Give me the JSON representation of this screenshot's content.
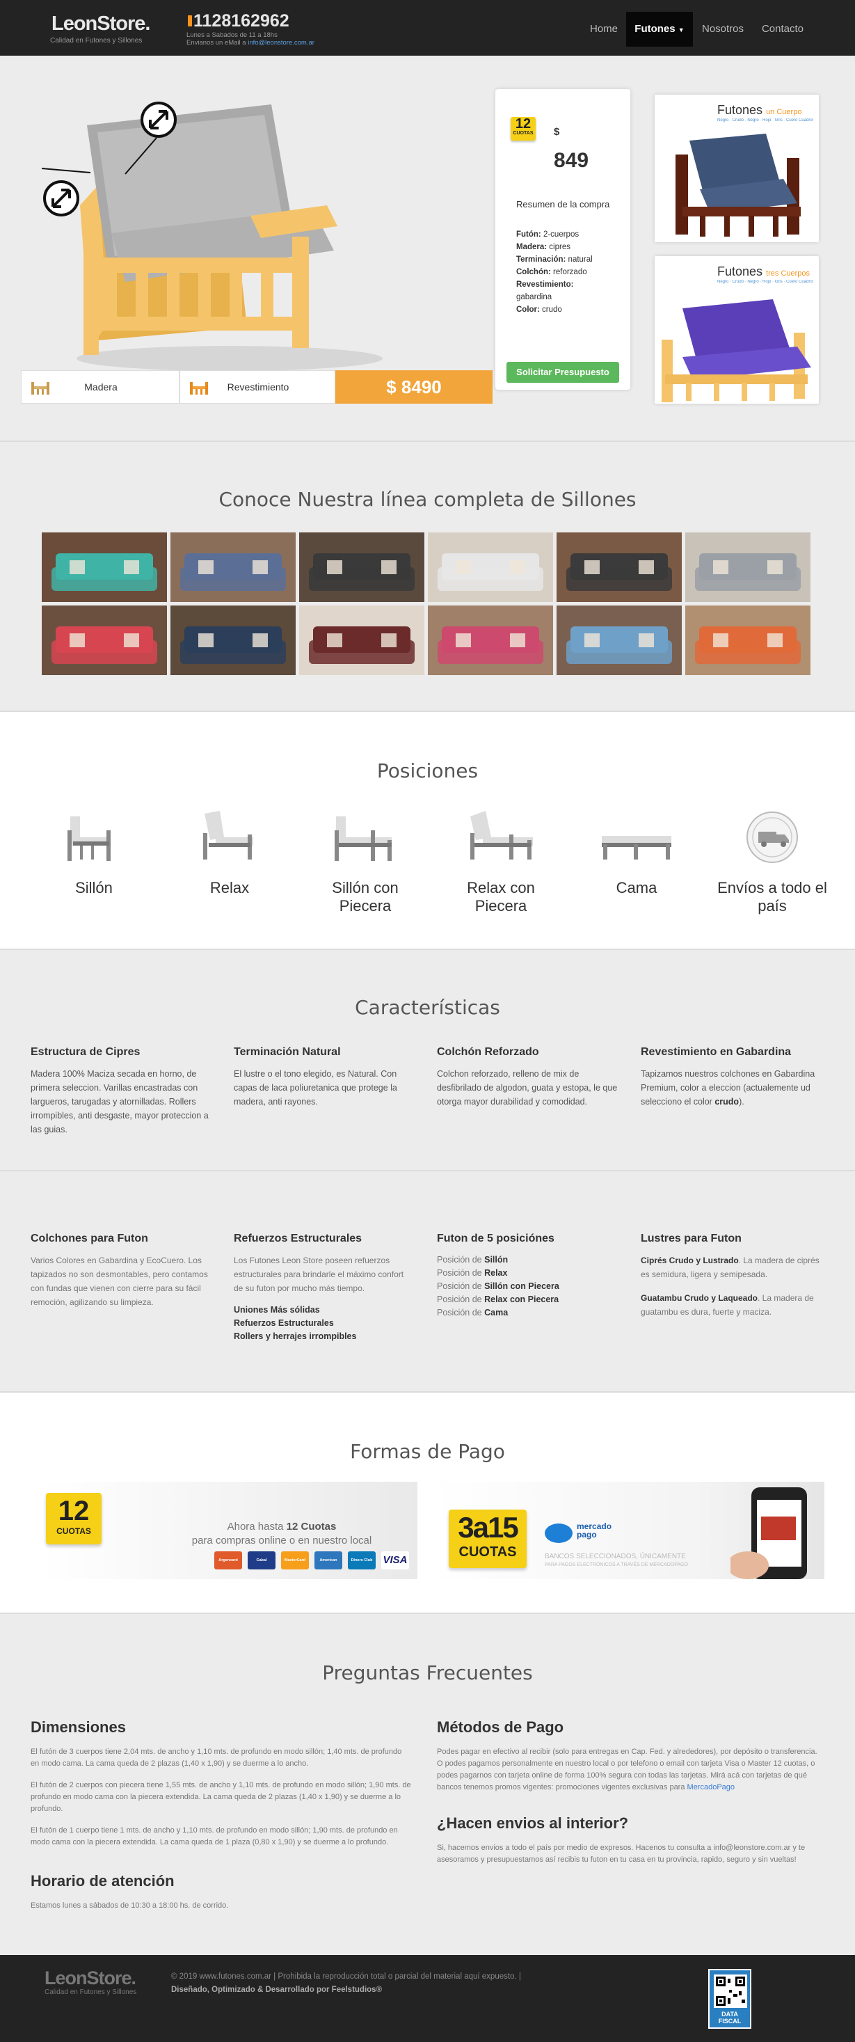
{
  "nav": {
    "brand": "LeonStore.",
    "brand_tagline": "Calidad en Futones y Sillones",
    "phone": "1128162962",
    "hours": "Lunes a Sabados de 11 a 18hs",
    "email_prefix": "Envianos un eMail a",
    "email": "info@leonstore.com.ar",
    "items": [
      "Home",
      "Futones",
      "Nosotros",
      "Contacto"
    ],
    "active": "Futones",
    "caret_icon": "caret-down-icon"
  },
  "product": {
    "options": [
      {
        "label": "Madera",
        "icon": "futon-frame-icon"
      },
      {
        "label": "Revestimiento",
        "icon": "futon-frame-icon"
      }
    ],
    "price_button": "$ 8490",
    "quote": {
      "badge_number": "12",
      "badge_label": "CUOTAS",
      "currency": "$",
      "amount": "849",
      "summary_title": "Resumen de la compra",
      "lines": [
        {
          "k": "Futón:",
          "v": "2-cuerpos"
        },
        {
          "k": "Madera:",
          "v": "cipres"
        },
        {
          "k": "Terminación:",
          "v": "natural"
        },
        {
          "k": "Colchón:",
          "v": "reforzado"
        },
        {
          "k": "Revestimiento:",
          "v": "gabardina"
        },
        {
          "k": "Color:",
          "v": "crudo"
        }
      ],
      "cta": "Solicitar Presupuesto"
    },
    "side_cards": [
      {
        "title": "Futones",
        "accent": "un Cuerpo",
        "sub": "Negro · Crudo · Negro · Rojo · Gris · Cuero Cuadros"
      },
      {
        "title": "Futones",
        "accent": "tres Cuerpos",
        "sub": "Negro · Crudo · Negro · Rojo · Gris · Cuero Cuadros"
      }
    ]
  },
  "sillones": {
    "title": "Conoce Nuestra línea completa de Sillones"
  },
  "positions": {
    "title": "Posiciones",
    "items": [
      {
        "label": "Sillón",
        "icon": "futon-sillon-icon"
      },
      {
        "label": "Relax",
        "icon": "futon-relax-icon"
      },
      {
        "label": "Sillón con Piecera",
        "icon": "futon-sillon-piecera-icon"
      },
      {
        "label": "Relax con Piecera",
        "icon": "futon-relax-piecera-icon"
      },
      {
        "label": "Cama",
        "icon": "futon-cama-icon"
      },
      {
        "label": "Envíos a todo el país",
        "icon": "shipping-truck-icon"
      }
    ]
  },
  "features": {
    "title": "Características",
    "row1": [
      {
        "title": "Estructura de Cipres",
        "text": "Madera 100% Maciza secada en horno, de primera seleccion. Varillas encastradas con largueros, tarugadas y atornilladas. Rollers irrompibles, anti desgaste, mayor proteccion a las guias."
      },
      {
        "title": "Terminación Natural",
        "text": "El lustre o el tono elegido, es Natural. Con capas de laca poliuretanica que protege la madera, anti rayones."
      },
      {
        "title": "Colchón Reforzado",
        "text": "Colchon reforzado, relleno de mix de desfibrilado de algodon, guata y estopa, le que otorga mayor durabilidad y comodidad."
      },
      {
        "title": "Revestimiento en Gabardina",
        "text": "Tapizamos nuestros colchones en Gabardina Premium, color a eleccion (actualemente ud selecciono el color",
        "bold": "crudo",
        "tail": ")."
      }
    ],
    "row2": [
      {
        "title": "Colchones para Futon",
        "text": "Varios Colores en Gabardina y EcoCuero. Los tapizados no son desmontables, pero contamos con fundas que vienen con cierre para su fácil remoción, agilizando su limpieza."
      },
      {
        "title": "Refuerzos Estructurales",
        "text": "Los Futones Leon Store poseen refuerzos estructurales para brindarle el máximo confort de su futon por mucho más tiempo.",
        "bold_lines": [
          "Uniones Más sólidas",
          "Refuerzos Estructurales",
          "Rollers y herrajes irrompibles"
        ]
      },
      {
        "title": "Futon de 5 posiciónes",
        "prefix": "Posición de",
        "positions": [
          "Sillón",
          "Relax",
          "Sillón con Piecera",
          "Relax con Piecera",
          "Cama"
        ]
      },
      {
        "title": "Lustres para Futon",
        "b1": "Ciprés Crudo y Lustrado",
        "t1": ". La madera de ciprés es semidura, ligera y semipesada.",
        "b2": "Guatambu Crudo y Laqueado",
        "t2": ". La madera de guatambu es dura, fuerte y maciza."
      }
    ]
  },
  "payments": {
    "title": "Formas de Pago",
    "left": {
      "badge_number": "12",
      "badge_label": "CUOTAS",
      "line1_pre": "Ahora hasta",
      "line1_b": "12 Cuotas",
      "line2": "para compras online o en nuestro local",
      "cards": [
        "Argencard",
        "Cabal",
        "MasterCard",
        "American Express",
        "Diners Club",
        "VISA"
      ]
    },
    "right": {
      "big": "3a15",
      "label": "CUOTAS",
      "mp_brand": "mercado pago",
      "note1": "BANCOS SELECCIONADOS, ÚNICAMENTE",
      "note2": "PARA PAGOS ELECTRÓNICOS A TRAVÉS DE MERCADOPAGO"
    }
  },
  "faq": {
    "title": "Preguntas Frecuentes",
    "dimensions": {
      "title": "Dimensiones",
      "paragraphs": [
        "El futón de 3 cuerpos tiene 2,04 mts. de ancho y 1,10 mts. de profundo en modo sillón; 1,40 mts. de profundo en modo cama. La cama queda de 2 plazas (1,40 x 1,90) y se duerme a lo ancho.",
        "El futón de 2 cuerpos con piecera tiene 1,55 mts. de ancho y 1,10 mts. de profundo en modo sillón; 1,90 mts. de profundo en modo cama con la piecera extendida. La cama queda de 2 plazas (1,40 x 1,90) y se duerme a lo profundo.",
        "El futón de 1 cuerpo tiene 1 mts. de ancho y 1,10 mts. de profundo en modo sillón; 1,90 mts. de profundo en modo cama con la piecera extendida. La cama queda de 1 plaza (0,80 x 1,90) y se duerme a lo profundo."
      ]
    },
    "hours": {
      "title": "Horario de atención",
      "text": "Estamos lunes a sábados de 10:30 a 18:00 hs. de corrido."
    },
    "payment_methods": {
      "title": "Métodos de Pago",
      "text": "Podes pagar en efectivo al recibir (solo para entregas en Cap. Fed. y alrededores), por depósito o transferencia. O podes pagarnos personalmente en nuestro local o por telefono o email con tarjeta Visa o Master 12 cuotas, o podes pagarnos con tarjeta online de forma 100% segura con todas las tarjetas. Mirá acá con tarjetas de qué bancos tenemos promos vigentes: promociones vigentes exclusivas para",
      "link": "MercadoPago"
    },
    "shipping": {
      "title": "¿Hacen envios al interior?",
      "text": "Si, hacemos envios a todo el país por medio de expresos. Hacenos tu consulta a info@leonstore.com.ar y te asesoramos y presupuestamos así recibis tu futon en tu casa en tu provincia, rapido, seguro y sin vueltas!"
    }
  },
  "footer": {
    "brand": "LeonStore.",
    "tagline": "Calidad en Futones y Sillones",
    "copy": "© 2019 www.futones.com.ar | Prohibida la reproducción total o parcial del material aquí expuesto. |",
    "credit": "Diseñado, Optimizado & Desarrollado por Feelstudios®",
    "badge": "DATA FISCAL"
  },
  "colors": {
    "accent": "#f7941d",
    "nav_bg": "#232323",
    "cta_green": "#5cb85c",
    "price_orange": "#f2a53a",
    "badge_yellow": "#f5d016",
    "wood": "#f5c46a",
    "mattress": "#b9b9b9"
  }
}
